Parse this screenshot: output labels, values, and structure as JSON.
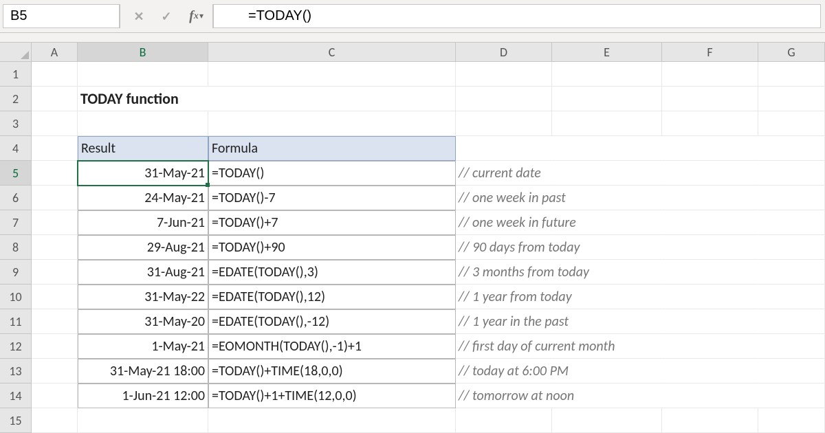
{
  "formula_bar": {
    "cell_ref": "B5",
    "formula": "=TODAY()"
  },
  "title": "TODAY function",
  "columns": [
    "A",
    "B",
    "C",
    "D",
    "E",
    "F",
    "G"
  ],
  "row_numbers": [
    1,
    2,
    3,
    4,
    5,
    6,
    7,
    8,
    9,
    10,
    11,
    12,
    13,
    14,
    15
  ],
  "active_col": "B",
  "active_row": 5,
  "table": {
    "headers": {
      "result": "Result",
      "formula": "Formula"
    },
    "rows": [
      {
        "result": "31-May-21",
        "formula": "=TODAY()",
        "comment": "// current date"
      },
      {
        "result": "24-May-21",
        "formula": "=TODAY()-7",
        "comment": "// one week in past"
      },
      {
        "result": "7-Jun-21",
        "formula": "=TODAY()+7",
        "comment": "// one week in future"
      },
      {
        "result": "29-Aug-21",
        "formula": "=TODAY()+90",
        "comment": "// 90 days from today"
      },
      {
        "result": "31-Aug-21",
        "formula": "=EDATE(TODAY(),3)",
        "comment": "// 3 months from today"
      },
      {
        "result": "31-May-22",
        "formula": "=EDATE(TODAY(),12)",
        "comment": "// 1 year from today"
      },
      {
        "result": "31-May-20",
        "formula": "=EDATE(TODAY(),-12)",
        "comment": "// 1 year in the past"
      },
      {
        "result": "1-May-21",
        "formula": "=EOMONTH(TODAY(),-1)+1",
        "comment": "// first day of current month"
      },
      {
        "result": "31-May-21 18:00",
        "formula": "=TODAY()+TIME(18,0,0)",
        "comment": "// today at 6:00 PM"
      },
      {
        "result": "1-Jun-21 12:00",
        "formula": "=TODAY()+1+TIME(12,0,0)",
        "comment": "// tomorrow at noon"
      }
    ]
  }
}
